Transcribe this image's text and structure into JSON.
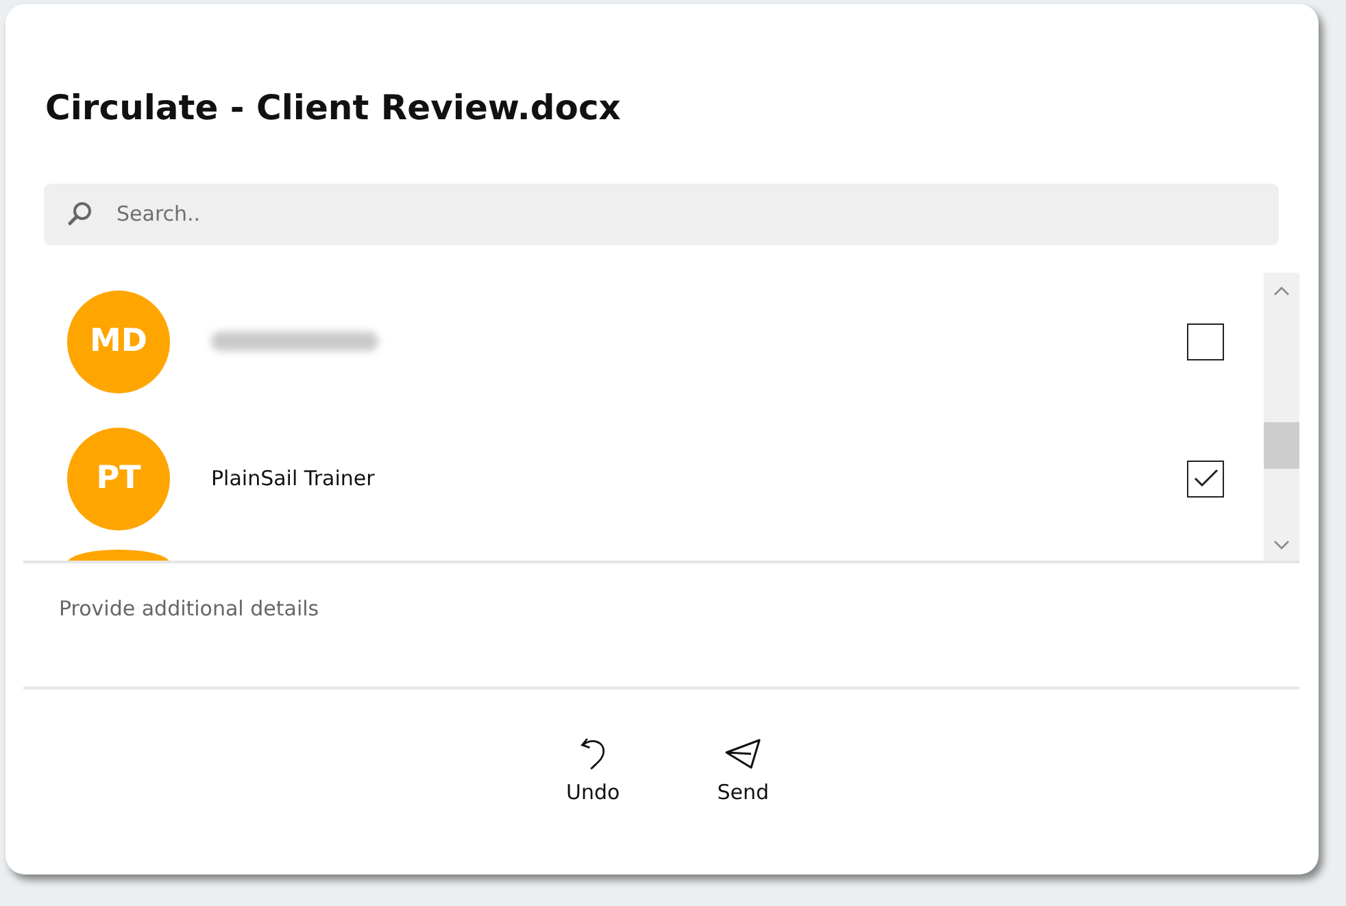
{
  "dialog": {
    "title": "Circulate - Client Review.docx"
  },
  "search": {
    "placeholder": "Search.."
  },
  "recipients": [
    {
      "kind": "row",
      "initials": "MD",
      "redacted": true,
      "checked": false
    },
    {
      "kind": "row",
      "initials": "PT",
      "name": "PlainSail Trainer",
      "redacted": false,
      "checked": true
    },
    {
      "kind": "cut-off"
    }
  ],
  "details": {
    "placeholder": "Provide additional details"
  },
  "buttons": [
    {
      "kind": "undo",
      "label": "Undo"
    },
    {
      "kind": "send",
      "label": "Send"
    }
  ]
}
